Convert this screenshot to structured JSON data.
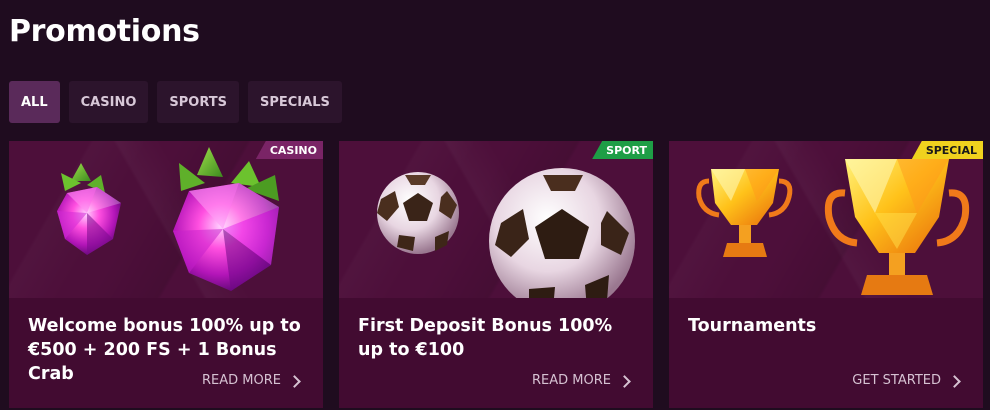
{
  "page": {
    "title": "Promotions"
  },
  "filters": [
    {
      "label": "ALL",
      "active": true
    },
    {
      "label": "CASINO",
      "active": false
    },
    {
      "label": "SPORTS",
      "active": false
    },
    {
      "label": "SPECIALS",
      "active": false
    }
  ],
  "cards": [
    {
      "badge": "CASINO",
      "image": "raspberry-gems-icon",
      "title": "Welcome bonus 100% up to €500 + 200 FS + 1 Bonus Crab",
      "link": "READ MORE"
    },
    {
      "badge": "SPORT",
      "image": "soccer-balls-icon",
      "title": "First Deposit Bonus 100% up to €100",
      "link": "READ MORE"
    },
    {
      "badge": "SPECIAL",
      "image": "trophies-icon",
      "title": "Tournaments",
      "link": "GET STARTED"
    }
  ],
  "colors": {
    "background": "#1f0c1f",
    "tab_active": "#5a2a5a",
    "tab_inactive": "#2c142c",
    "card": "#420b31",
    "badge_casino": "#7a2466",
    "badge_sport": "#1e9e46",
    "badge_special": "#f0d21e"
  }
}
